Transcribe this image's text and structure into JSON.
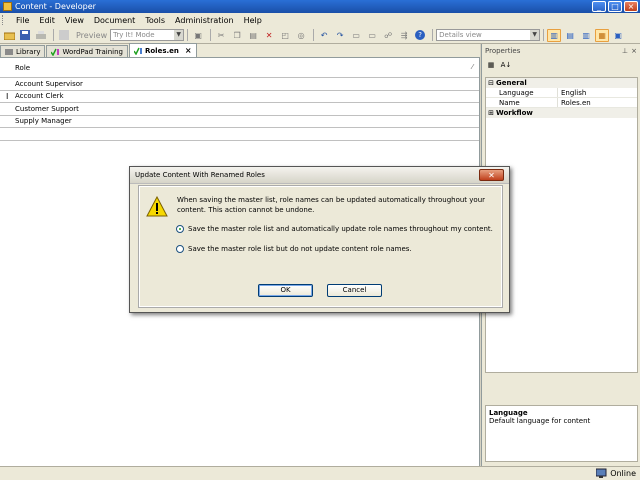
{
  "window": {
    "title": "Content - Developer",
    "controls": [
      "_",
      "□",
      "×"
    ]
  },
  "menu": [
    "File",
    "Edit",
    "View",
    "Document",
    "Tools",
    "Administration",
    "Help"
  ],
  "toolbar": {
    "preview_label": "Preview",
    "mode_select": "Try It! Mode",
    "view_select": "Details view"
  },
  "tabs": [
    {
      "label": "Library",
      "selected": false
    },
    {
      "label": "WordPad Training",
      "selected": false
    },
    {
      "label": "Roles.en",
      "selected": true
    }
  ],
  "grid": {
    "column": "Role",
    "rows": [
      "Account Supervisor",
      "Account Clerk",
      "Customer Support",
      "Supply Manager"
    ]
  },
  "properties": {
    "title": "Properties",
    "categories": [
      {
        "name": "General",
        "expanded": true,
        "items": [
          {
            "key": "Language",
            "value": "English"
          },
          {
            "key": "Name",
            "value": "Roles.en"
          }
        ]
      },
      {
        "name": "Workflow",
        "expanded": false,
        "items": []
      }
    ],
    "description_title": "Language",
    "description_text": "Default language for content"
  },
  "status": {
    "text": "Online"
  },
  "dialog": {
    "title": "Update Content With Renamed Roles",
    "message": "When saving the master list, role names can be updated automatically throughout your content.  This action cannot be undone.",
    "option1": "Save the master role list and automatically update role names throughout my content.",
    "option2": "Save the master role list but do not update content role names.",
    "selected_option": 1,
    "ok_label": "OK",
    "cancel_label": "Cancel"
  }
}
